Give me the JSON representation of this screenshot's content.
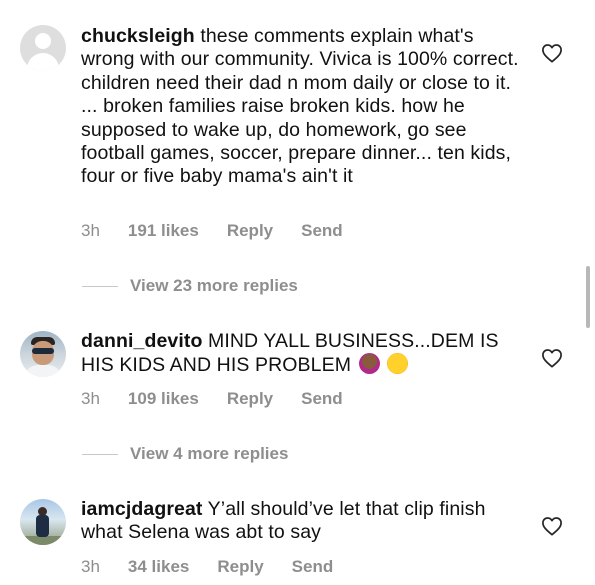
{
  "comments": [
    {
      "username": "chucksleigh",
      "text": " these comments explain what's wrong with our community. Vivica is 100% correct.  children need their dad n mom daily or close to it. ... broken families raise broken kids. how he supposed to wake up,  do homework,  go see football games,  soccer, prepare dinner... ten kids,  four or five baby mama's ain't it",
      "time": "3h",
      "likes": "191 likes",
      "reply": "Reply",
      "send": "Send",
      "avatar": "default-avatar"
    },
    {
      "username": "danni_devito",
      "text": " MIND YALL BUSINESS...DEM IS HIS KIDS AND HIS PROBLEM ",
      "emojis": [
        "woman-shrugging",
        "rolling-on-floor-laughing"
      ],
      "time": "3h",
      "likes": "109 likes",
      "reply": "Reply",
      "send": "Send",
      "avatar": "photo-avatar"
    },
    {
      "username": "iamcjdagreat",
      "text": " Y’all should’ve let that clip finish what Selena was abt to say",
      "time": "3h",
      "likes": "34 likes",
      "reply": "Reply",
      "send": "Send",
      "avatar": "photo-avatar"
    }
  ],
  "view_more": [
    {
      "label": "View 23 more replies"
    },
    {
      "label": "View 4 more replies"
    }
  ],
  "icons": {
    "like": "heart-outline-icon"
  },
  "colors": {
    "text": "#111111",
    "meta": "#8e8e8e",
    "divider": "#c7c7c7"
  }
}
